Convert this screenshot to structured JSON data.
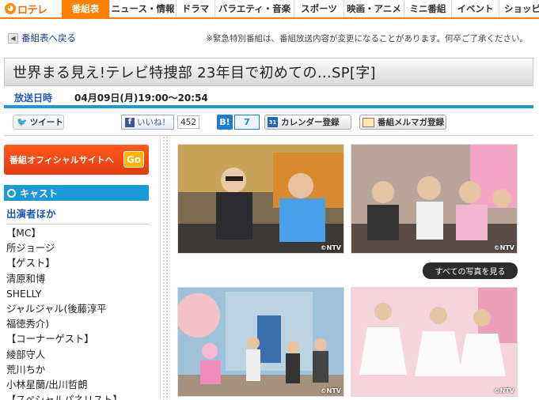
{
  "nav": {
    "logo": "ロテレ",
    "items": [
      "番組表",
      "ニュース・情報",
      "ドラマ",
      "バラエティ・音楽",
      "スポーツ",
      "映画・アニメ",
      "ミニ番組",
      "イベント",
      "ショッピ"
    ]
  },
  "back_link": "番組表へ戻る",
  "notice": "※緊急特別番組は、番組放送内容が変更になることがあります。何卒ご了承ください。",
  "program": {
    "title": "世界まる見え!テレビ特捜部 23年目で初めての…SP[字]",
    "date_label": "放送日時",
    "date_value": "04月09日(月)19:00〜20:54"
  },
  "social": {
    "tweet": "ツイート",
    "like": "いいね！",
    "like_count": "452",
    "hatena_icon": "B!",
    "hatena_count": "7",
    "calendar_icon": "31",
    "calendar": "カレンダー登録",
    "mailmag": "番組メルマガ登録"
  },
  "sidebar": {
    "official_site": "番組オフィシャルサイトへ",
    "official_go": "Go",
    "cast_heading": "キャスト",
    "cast_subheading": "出演者ほか",
    "cast": [
      "【MC】",
      "所ジョージ",
      "【ゲスト】",
      "清原和博",
      "SHELLY",
      "ジャルジャル(後藤淳平",
      "福徳秀介)",
      "【コーナーゲスト】",
      "綾部守人",
      "荒川ちか",
      "小林星蘭/出川哲朗",
      "【スペシャルパネリスト】"
    ]
  },
  "photos": {
    "credit": "©NTV",
    "see_all": "すべての写真を見る"
  },
  "colors": {
    "nav_accent": "#ff7f00",
    "link_blue": "#1a55b8",
    "section_blue": "#1a9ad6",
    "official_orange": "#e84a18"
  }
}
